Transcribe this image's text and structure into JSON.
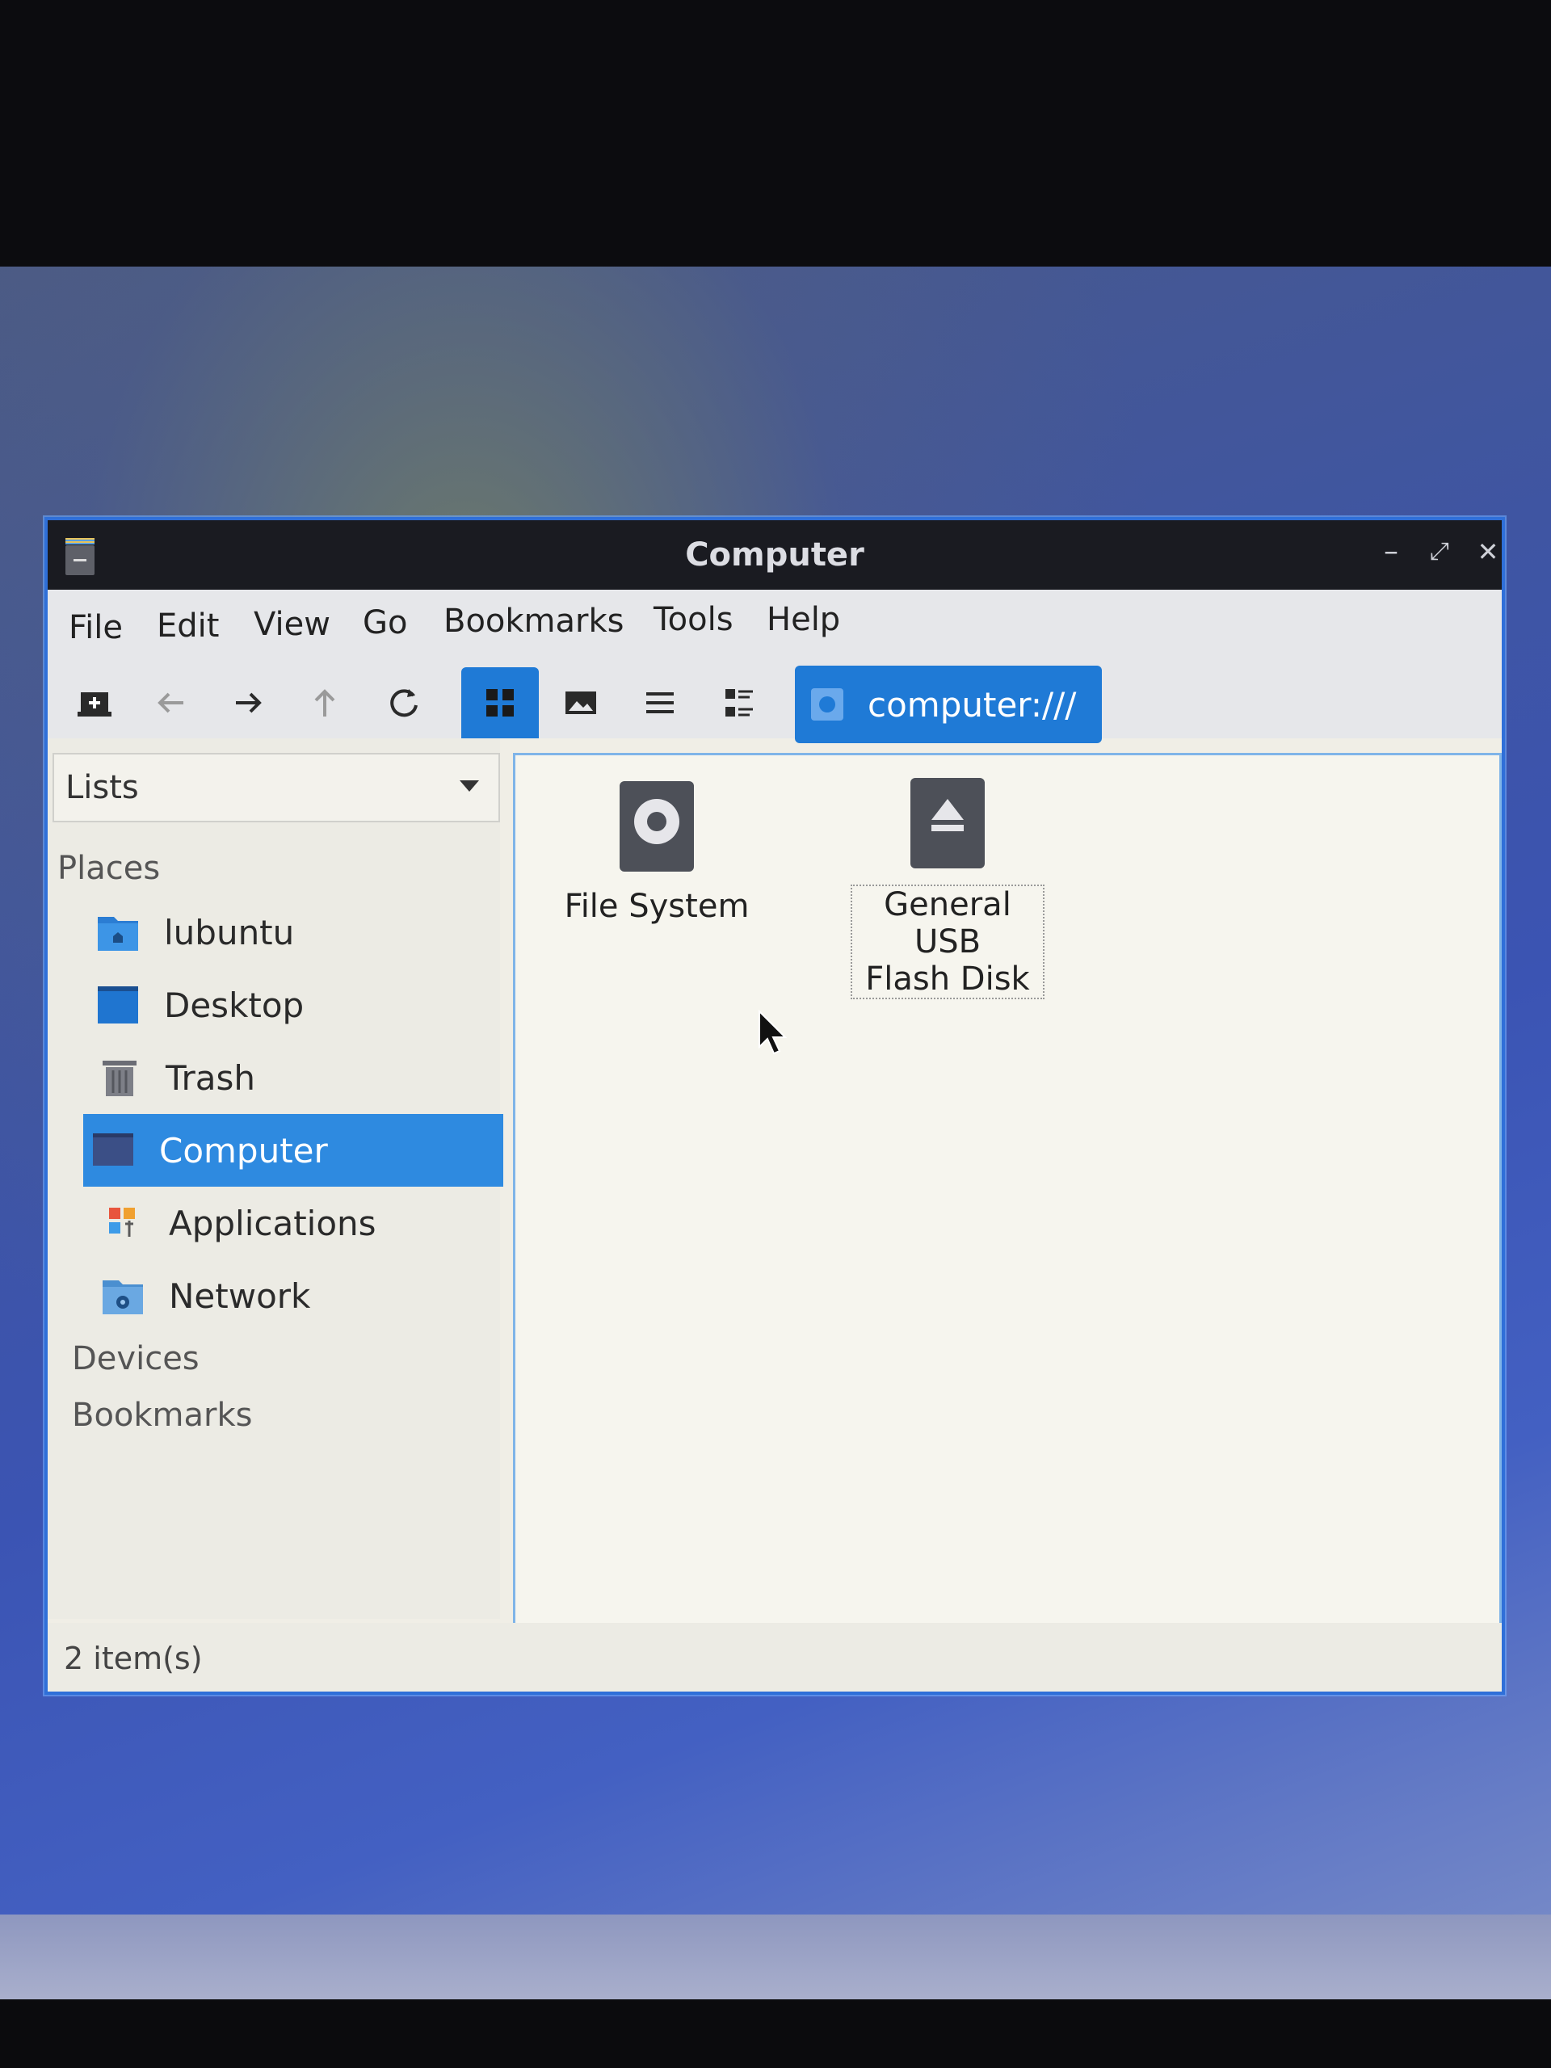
{
  "window": {
    "title": "Computer",
    "controls": {
      "minimize": "–",
      "maximize": "⤢",
      "close": "✕"
    }
  },
  "menubar": [
    "File",
    "Edit",
    "View",
    "Go",
    "Bookmarks",
    "Tools",
    "Help"
  ],
  "toolbar": {
    "buttons": [
      "new-tab-icon",
      "back-icon",
      "forward-icon",
      "up-icon",
      "reload-icon",
      "icon-view-icon",
      "thumbnail-view-icon",
      "list-view-icon",
      "detailed-view-icon"
    ],
    "active_view": "icon-view",
    "location": "computer:///"
  },
  "sidebar": {
    "combo_value": "Lists",
    "places_header": "Places",
    "places": [
      {
        "label": "lubuntu",
        "icon": "home-folder-icon"
      },
      {
        "label": "Desktop",
        "icon": "desktop-icon"
      },
      {
        "label": "Trash",
        "icon": "trash-icon"
      },
      {
        "label": "Computer",
        "icon": "computer-icon",
        "selected": true
      },
      {
        "label": "Applications",
        "icon": "applications-icon"
      },
      {
        "label": "Network",
        "icon": "network-folder-icon"
      }
    ],
    "devices_header": "Devices",
    "bookmarks_header": "Bookmarks"
  },
  "files": [
    {
      "label": "File System",
      "icon": "hard-drive-icon"
    },
    {
      "label_line1": "General USB",
      "label_line2": "Flash Disk",
      "icon": "eject-drive-icon"
    }
  ],
  "status": {
    "text": "2 item(s)"
  },
  "colors": {
    "accent": "#1f7ad6",
    "selection": "#2e8ae0",
    "titlebar": "#1a1b21",
    "window_border": "#2f6fd8"
  }
}
